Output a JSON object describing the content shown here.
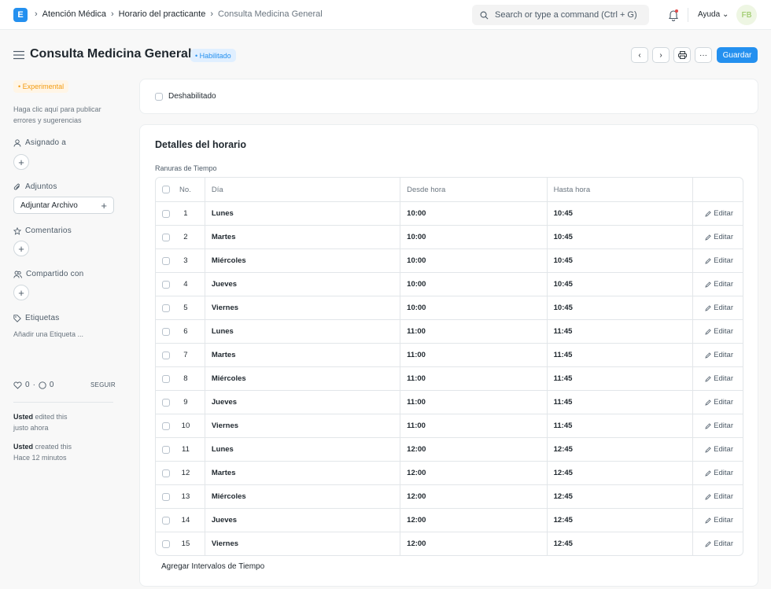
{
  "navbar": {
    "logo_letter": "E",
    "breadcrumbs": [
      "Atención Médica",
      "Horario del practicante",
      "Consulta Medicina General"
    ],
    "search_placeholder": "Search or type a command (Ctrl + G)",
    "help_label": "Ayuda",
    "avatar_initials": "FB"
  },
  "header": {
    "title": "Consulta Medicina General",
    "status_badge": "• Habilitado",
    "save_label": "Guardar"
  },
  "sidebar": {
    "experimental_badge": "• Experimental",
    "feedback_text_1": "Haga clic aquí para publicar",
    "feedback_text_2": "errores y sugerencias",
    "assigned_label": "Asignado a",
    "attachments_label": "Adjuntos",
    "attach_button": "Adjuntar Archivo",
    "comments_label": "Comentarios",
    "shared_label": "Compartido con",
    "tags_label": "Etiquetas",
    "add_tag": "Añadir una Etiqueta ...",
    "likes_count": "0",
    "comments_count": "0",
    "follow_label": "SEGUIR",
    "activity": [
      {
        "user": "Usted",
        "action": "edited this",
        "time": "justo ahora"
      },
      {
        "user": "Usted",
        "action": "created this",
        "time": "Hace 12 minutos"
      }
    ]
  },
  "form": {
    "disabled_label": "Deshabilitado",
    "section_title": "Detalles del horario",
    "grid_label": "Ranuras de Tiempo",
    "columns": {
      "no": "No.",
      "day": "Día",
      "from": "Desde hora",
      "to": "Hasta hora"
    },
    "edit_label": "Editar",
    "add_rows_label": "Agregar Intervalos de Tiempo",
    "rows": [
      {
        "no": "1",
        "day": "Lunes",
        "from": "10:00",
        "to": "10:45"
      },
      {
        "no": "2",
        "day": "Martes",
        "from": "10:00",
        "to": "10:45"
      },
      {
        "no": "3",
        "day": "Miércoles",
        "from": "10:00",
        "to": "10:45"
      },
      {
        "no": "4",
        "day": "Jueves",
        "from": "10:00",
        "to": "10:45"
      },
      {
        "no": "5",
        "day": "Viernes",
        "from": "10:00",
        "to": "10:45"
      },
      {
        "no": "6",
        "day": "Lunes",
        "from": "11:00",
        "to": "11:45"
      },
      {
        "no": "7",
        "day": "Martes",
        "from": "11:00",
        "to": "11:45"
      },
      {
        "no": "8",
        "day": "Miércoles",
        "from": "11:00",
        "to": "11:45"
      },
      {
        "no": "9",
        "day": "Jueves",
        "from": "11:00",
        "to": "11:45"
      },
      {
        "no": "10",
        "day": "Viernes",
        "from": "11:00",
        "to": "11:45"
      },
      {
        "no": "11",
        "day": "Lunes",
        "from": "12:00",
        "to": "12:45"
      },
      {
        "no": "12",
        "day": "Martes",
        "from": "12:00",
        "to": "12:45"
      },
      {
        "no": "13",
        "day": "Miércoles",
        "from": "12:00",
        "to": "12:45"
      },
      {
        "no": "14",
        "day": "Jueves",
        "from": "12:00",
        "to": "12:45"
      },
      {
        "no": "15",
        "day": "Viernes",
        "from": "12:00",
        "to": "12:45"
      }
    ]
  }
}
